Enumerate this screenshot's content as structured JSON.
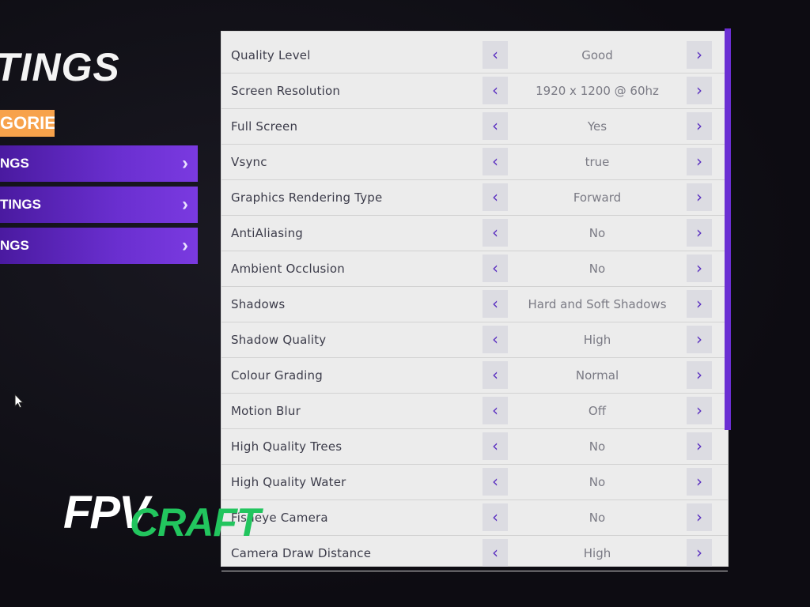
{
  "header": {
    "title": "TINGS",
    "categories_label": "GORIES"
  },
  "categories": [
    {
      "label": "NGS"
    },
    {
      "label": "TINGS"
    },
    {
      "label": "NGS"
    }
  ],
  "settings": [
    {
      "label": "Quality Level",
      "value": "Good"
    },
    {
      "label": "Screen Resolution",
      "value": "1920 x 1200 @ 60hz"
    },
    {
      "label": "Full Screen",
      "value": "Yes"
    },
    {
      "label": "Vsync",
      "value": "true"
    },
    {
      "label": "Graphics Rendering Type",
      "value": "Forward"
    },
    {
      "label": "AntiAliasing",
      "value": "No"
    },
    {
      "label": "Ambient Occlusion",
      "value": "No"
    },
    {
      "label": "Shadows",
      "value": "Hard and Soft Shadows"
    },
    {
      "label": "Shadow Quality",
      "value": "High"
    },
    {
      "label": "Colour Grading",
      "value": "Normal"
    },
    {
      "label": "Motion Blur",
      "value": "Off"
    },
    {
      "label": "High Quality Trees",
      "value": "No"
    },
    {
      "label": "High Quality Water",
      "value": "No"
    },
    {
      "label": "Fisheye Camera",
      "value": "No"
    },
    {
      "label": "Camera Draw Distance",
      "value": "High"
    }
  ],
  "arrows": {
    "left": "‹",
    "right": "›",
    "category": "›"
  },
  "logo": {
    "part1": "FPV",
    "part2": "CRAFT"
  },
  "colors": {
    "accent_purple": "#6b2fd3",
    "category_orange": "#f7a24b",
    "logo_green": "#22c55e"
  }
}
